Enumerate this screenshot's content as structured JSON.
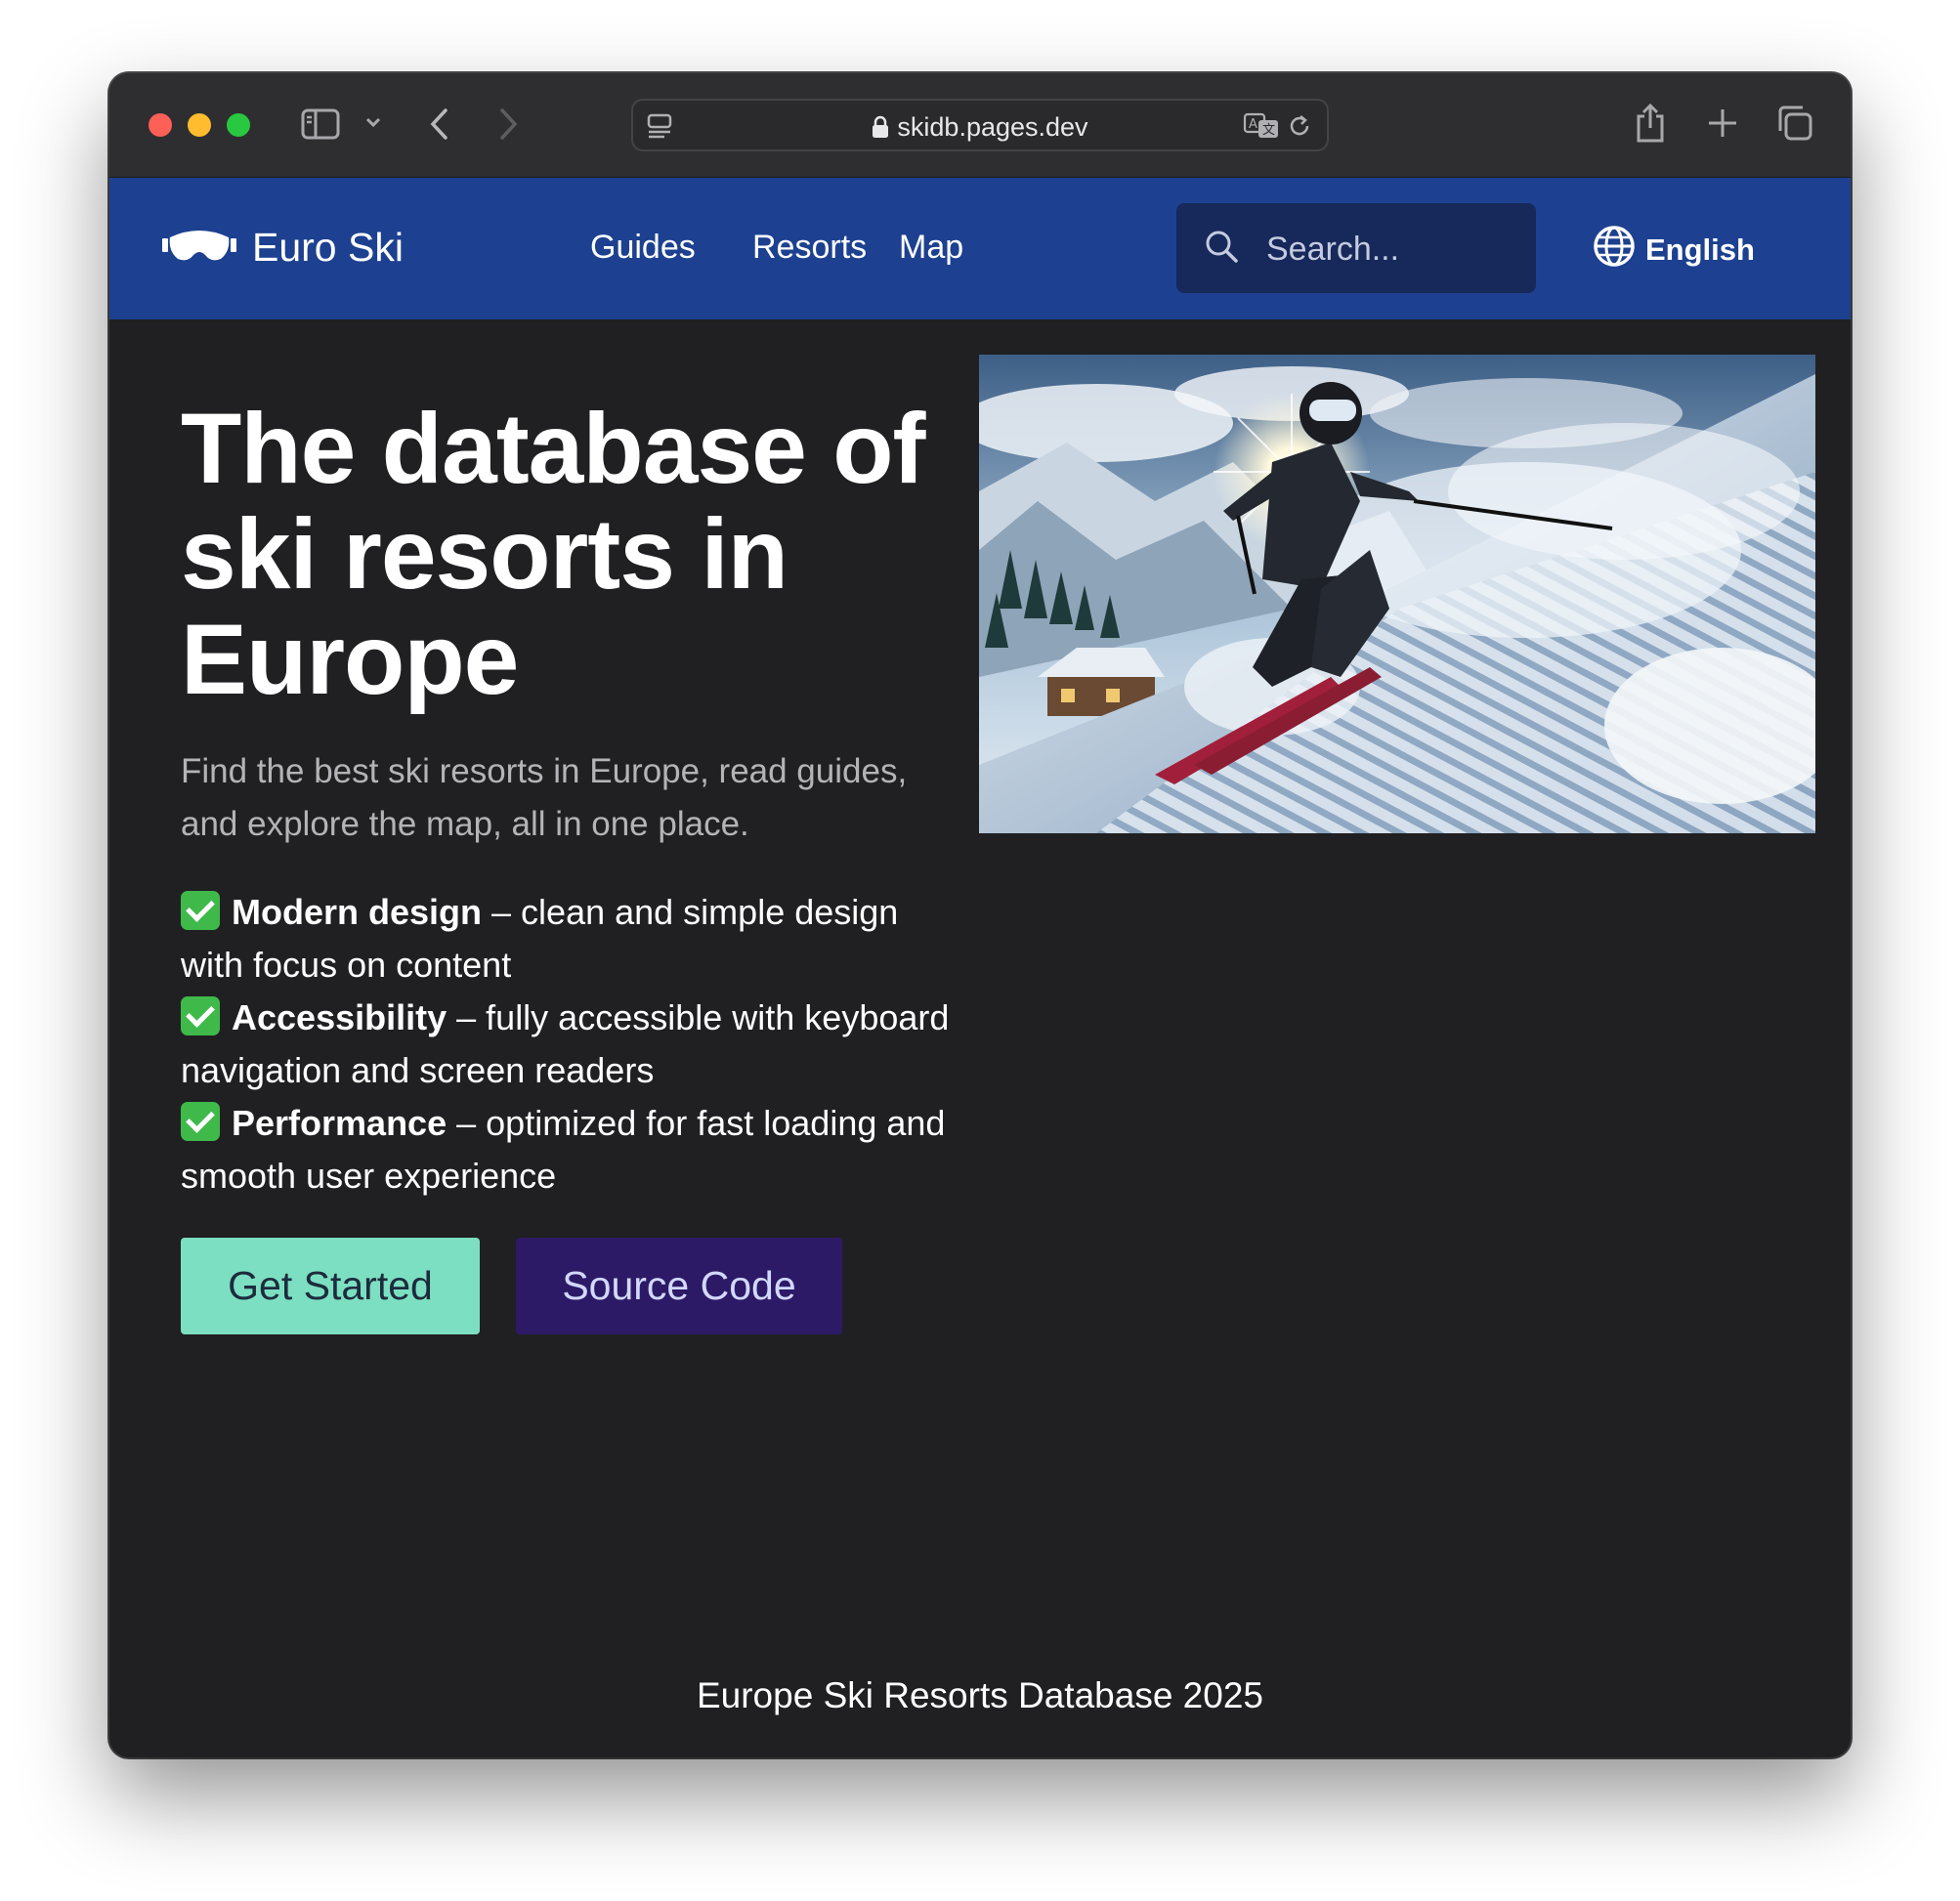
{
  "browser": {
    "url": "skidb.pages.dev"
  },
  "site": {
    "brand": "Euro Ski",
    "nav": [
      {
        "label": "Guides"
      },
      {
        "label": "Resorts"
      },
      {
        "label": "Map"
      }
    ],
    "search_placeholder": "Search...",
    "language": "English"
  },
  "hero": {
    "title": "The database of ski resorts in Europe",
    "subtitle": "Find the best ski resorts in Europe, read guides, and explore the map, all in one place.",
    "features": [
      {
        "title": "Modern design",
        "text": "– clean and simple design with focus on content"
      },
      {
        "title": "Accessibility",
        "text": "– fully accessible with keyboard navigation and screen readers"
      },
      {
        "title": "Performance",
        "text": "– optimized for fast loading and smooth user experience"
      }
    ],
    "primary_button": "Get Started",
    "secondary_button": "Source Code"
  },
  "footer": {
    "text": "Europe Ski Resorts Database 2025"
  },
  "colors": {
    "nav_bg": "#1d4190",
    "page_bg": "#202022",
    "primary_button": "#7ddfc2",
    "secondary_button": "#2d1a66"
  },
  "icons": {
    "brand": "ski-goggles-icon",
    "search": "search-icon",
    "language": "globe-icon"
  }
}
